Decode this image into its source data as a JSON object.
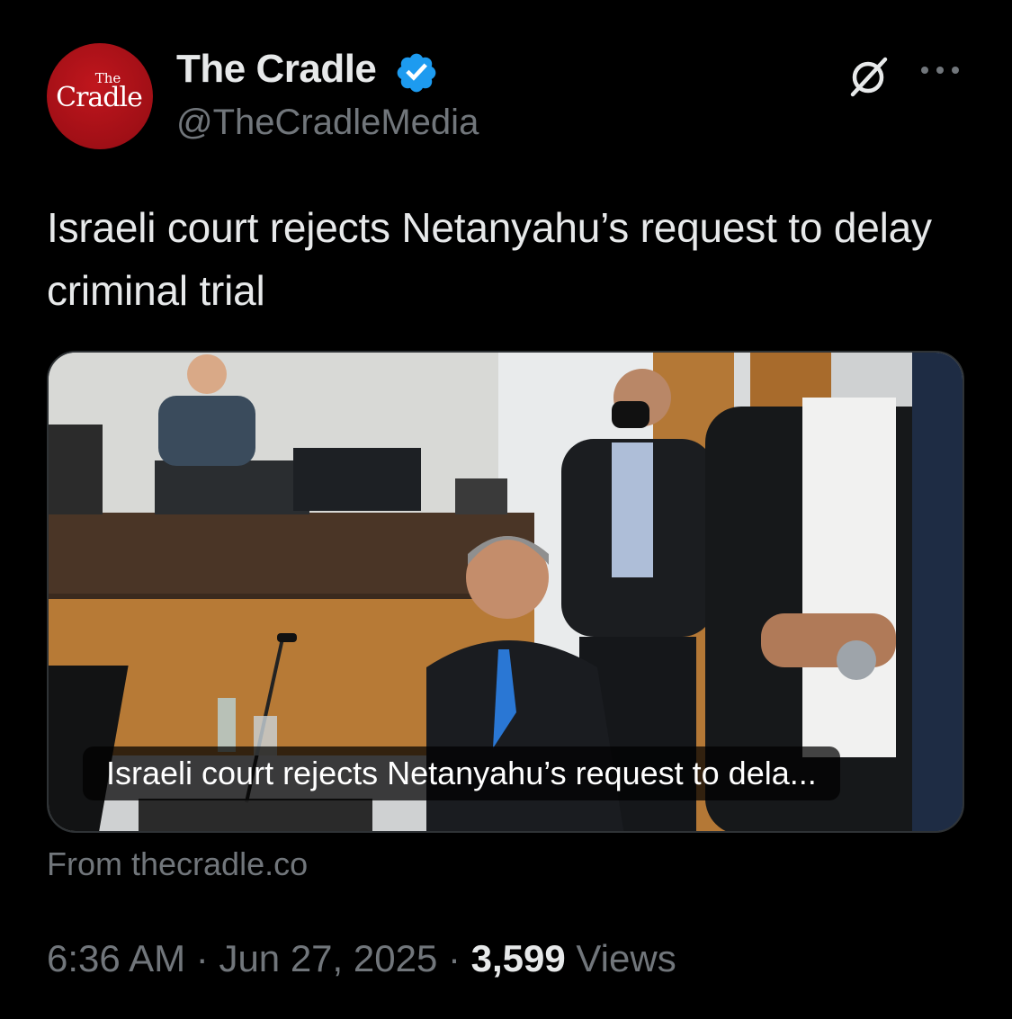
{
  "author": {
    "display_name": "The Cradle",
    "handle": "@TheCradleMedia",
    "verified": true,
    "avatar_text_top": "The",
    "avatar_text_main": "Cradle",
    "avatar_color": "#b3121a"
  },
  "actions": {
    "grok_icon": "grok-icon",
    "more_icon": "more-options-icon"
  },
  "tweet": {
    "text": "Israeli court rejects Netanyahu’s request to delay criminal trial"
  },
  "link_card": {
    "caption": "Israeli court rejects Netanyahu’s request to dela...",
    "source": "From thecradle.co"
  },
  "meta": {
    "time": "6:36 AM",
    "separator": " · ",
    "date": "Jun 27, 2025",
    "views_count": "3,599",
    "views_label": " Views"
  },
  "colors": {
    "background": "#000000",
    "text_primary": "#e7e9ea",
    "text_secondary": "#71767b",
    "verified_blue": "#1d9bf0"
  }
}
